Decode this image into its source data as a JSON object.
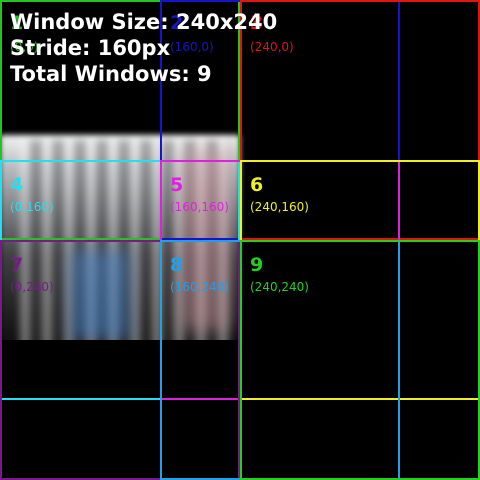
{
  "overlay": {
    "window_size": "Window Size: 240x240",
    "stride": "Stride: 160px",
    "total": "Total Windows: 9"
  },
  "windows": [
    {
      "num": "1",
      "coord": "(0,0)",
      "color": "#22c322"
    },
    {
      "num": "2",
      "coord": "(160,0)",
      "color": "#1515c8"
    },
    {
      "num": "3",
      "coord": "(240,0)",
      "color": "#e01414"
    },
    {
      "num": "4",
      "coord": "(0,160)",
      "color": "#22e0f0"
    },
    {
      "num": "5",
      "coord": "(160,160)",
      "color": "#e020e0"
    },
    {
      "num": "6",
      "coord": "(240,160)",
      "color": "#f0f020"
    },
    {
      "num": "7",
      "coord": "(0,240)",
      "color": "#7a1a8a"
    },
    {
      "num": "8",
      "coord": "(160,240)",
      "color": "#20a0e8"
    },
    {
      "num": "9",
      "coord": "(240,240)",
      "color": "#22d022"
    }
  ]
}
